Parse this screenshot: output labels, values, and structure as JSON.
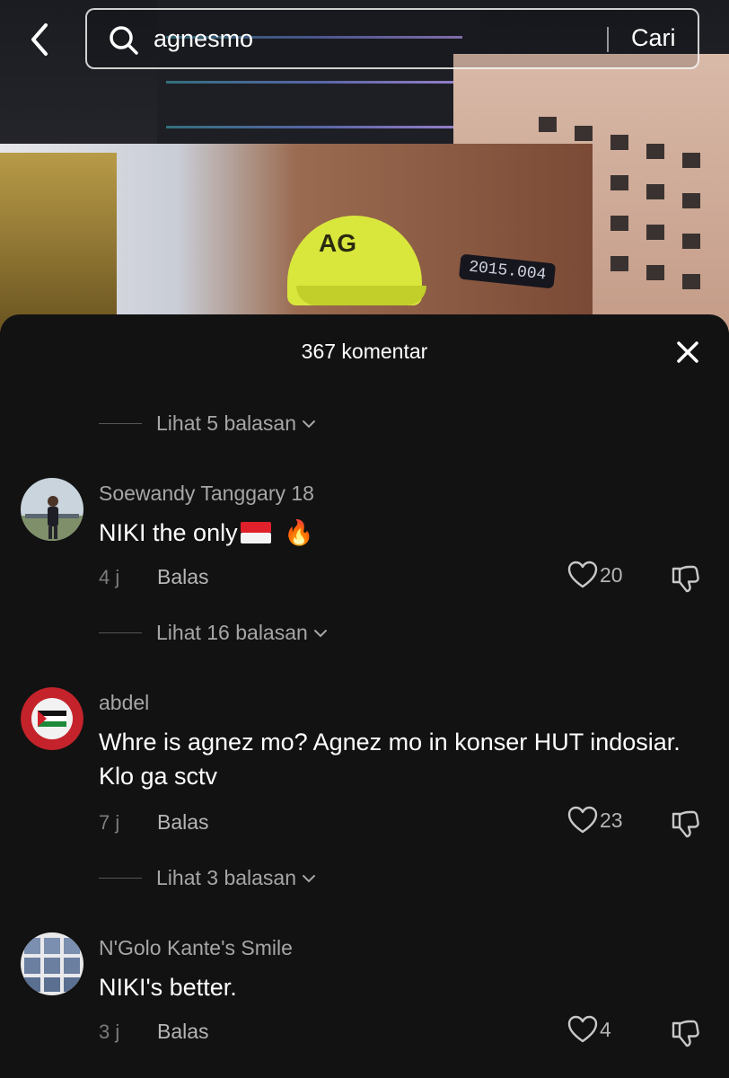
{
  "search": {
    "query": "agnesmo",
    "submit_label": "Cari"
  },
  "background": {
    "cap_logo": "AG",
    "screen_date": "2015.004"
  },
  "comments_sheet": {
    "title": "367 komentar",
    "replies_toggles": [
      {
        "label": "Lihat 5 balasan"
      },
      {
        "label": "Lihat 16 balasan"
      },
      {
        "label": "Lihat 3 balasan"
      }
    ],
    "comments": [
      {
        "username": "Soewandy Tanggary 18",
        "text": "NIKI the only",
        "emoji": "🔥",
        "time": "4 j",
        "reply_label": "Balas",
        "likes": "20"
      },
      {
        "username": "abdel",
        "text": "Whre is agnez mo? Agnez mo in konser HUT indosiar. Klo ga sctv",
        "time": "7 j",
        "reply_label": "Balas",
        "likes": "23"
      },
      {
        "username": "N'Golo Kante's Smile",
        "text": "NIKI's better.",
        "time": "3 j",
        "reply_label": "Balas",
        "likes": "4"
      }
    ]
  }
}
